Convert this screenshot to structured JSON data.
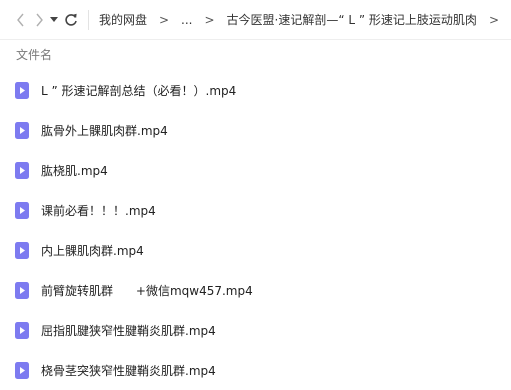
{
  "toolbar": {
    "breadcrumb": [
      "我的网盘",
      "...",
      "古今医盟·速记解剖—“ L ” 形速记上肢运动肌肉"
    ],
    "separator": ">"
  },
  "list": {
    "column_header": "文件名",
    "files": [
      "L ” 形速记解剖总结（必看！）.mp4",
      "肱骨外上髁肌肉群.mp4",
      "肱桡肌.mp4",
      "课前必看！！！.mp4",
      "内上髁肌肉群.mp4",
      "前臂旋转肌群      +微信mqw457.mp4",
      "屈指肌腱狭窄性腱鞘炎肌群.mp4",
      "桡骨茎突狭窄性腱鞘炎肌群.mp4"
    ]
  },
  "colors": {
    "file_icon": "#7d7bf0",
    "icon_gray": "#8a8a8a"
  }
}
